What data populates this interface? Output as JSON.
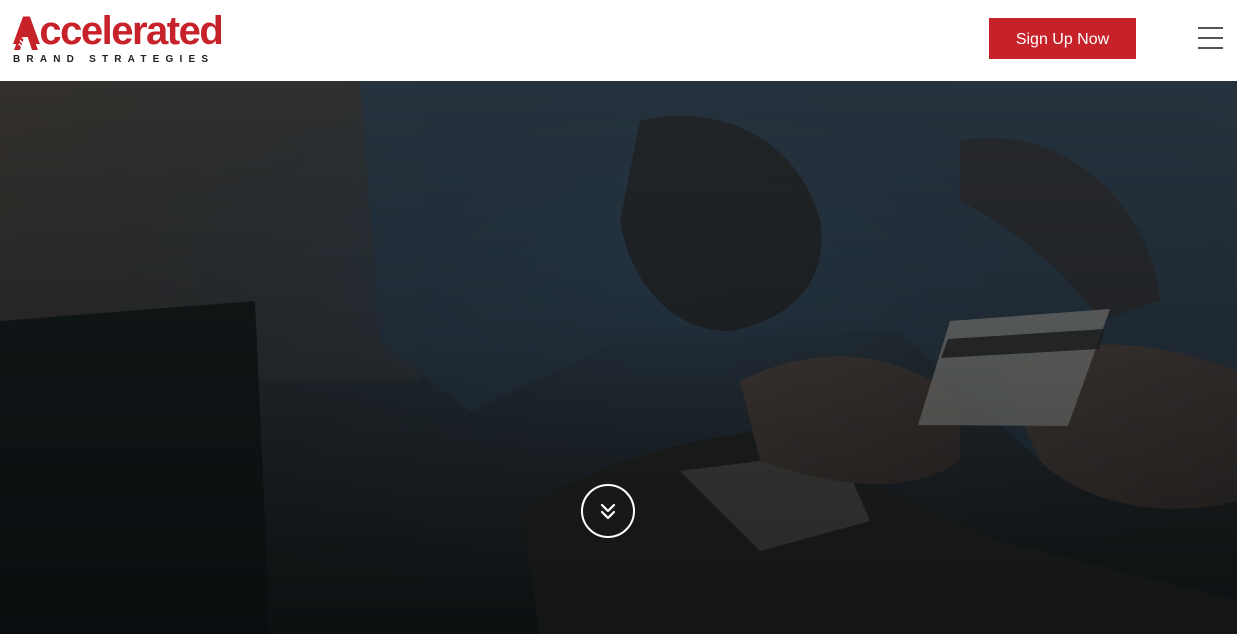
{
  "header": {
    "logo": {
      "wordmark": "Accelerated",
      "tagline": "BRAND STRATEGIES",
      "brand_color": "#c7222a"
    },
    "signup_label": "Sign Up Now",
    "menu_icon": "hamburger-menu-icon"
  },
  "hero": {
    "image": "person handing credit card over payment terminal (darkened background photo)",
    "scroll_icon": "double-chevron-down-icon"
  },
  "colors": {
    "accent": "#c7222a",
    "header_bg": "#ffffff",
    "overlay": "#1c2224"
  }
}
